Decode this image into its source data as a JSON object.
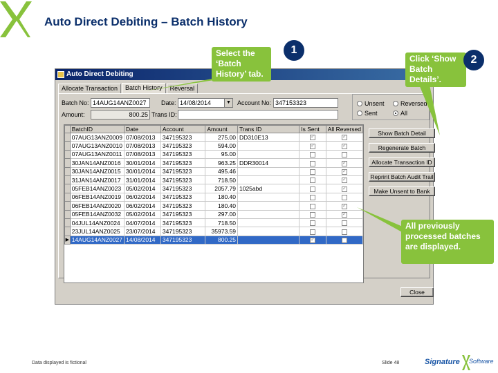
{
  "slide": {
    "title": "Auto Direct Debiting – Batch History",
    "footer_note": "Data displayed is fictional",
    "slide_number": "Slide 48",
    "brand": {
      "signature": "Signature",
      "software": "Software"
    },
    "colors": {
      "title": "#0b2f6b",
      "callout": "#88c23c",
      "badge": "#0b2f6b",
      "selection": "#3169c6"
    }
  },
  "window": {
    "title": "Auto Direct Debiting",
    "tabs": [
      "Allocate Transaction",
      "Batch History",
      "Reversal"
    ],
    "active_tab": "Batch History",
    "fields": {
      "batch_no_label": "Batch No:",
      "batch_no_value": "14AUG14ANZ0027",
      "date_label": "Date:",
      "date_value": "14/08/2014",
      "account_no_label": "Account No:",
      "account_no_value": "347153323",
      "amount_label": "Amount:",
      "amount_value": "800.25",
      "trans_id_label": "Trans ID:",
      "trans_id_value": ""
    },
    "filter": {
      "options": [
        "Unsent",
        "Reversed",
        "Sent",
        "All"
      ],
      "selected": "All"
    },
    "grid": {
      "columns": [
        "BatchID",
        "Date",
        "Account",
        "Amount",
        "Trans ID",
        "Is Sent",
        "All Reversed"
      ],
      "rows": [
        {
          "batch": "07AUG13ANZ0009",
          "date": "07/08/2013",
          "account": "347195323",
          "amount": "275.00",
          "trans": "DD310E13",
          "sent": true,
          "reversed": true
        },
        {
          "batch": "07AUG13ANZ0010",
          "date": "07/08/2013",
          "account": "347195323",
          "amount": "594.00",
          "trans": "",
          "sent": true,
          "reversed": true
        },
        {
          "batch": "07AUG13ANZ0011",
          "date": "07/08/2013",
          "account": "347195323",
          "amount": "95.00",
          "trans": "",
          "sent": false,
          "reversed": false
        },
        {
          "batch": "30JAN14ANZ0016",
          "date": "30/01/2014",
          "account": "347195323",
          "amount": "963.25",
          "trans": "DDR30014",
          "sent": false,
          "reversed": true
        },
        {
          "batch": "30JAN14ANZ0015",
          "date": "30/01/2014",
          "account": "347195323",
          "amount": "495.46",
          "trans": "",
          "sent": false,
          "reversed": true
        },
        {
          "batch": "31JAN14ANZ0017",
          "date": "31/01/2014",
          "account": "347195323",
          "amount": "718.50",
          "trans": "",
          "sent": false,
          "reversed": true
        },
        {
          "batch": "05FEB14ANZ0023",
          "date": "05/02/2014",
          "account": "347195323",
          "amount": "2057.79",
          "trans": "1025abd",
          "sent": false,
          "reversed": true
        },
        {
          "batch": "06FEB14ANZ0019",
          "date": "06/02/2014",
          "account": "347195323",
          "amount": "180.40",
          "trans": "",
          "sent": false,
          "reversed": false
        },
        {
          "batch": "06FEB14ANZ0020",
          "date": "06/02/2014",
          "account": "347195323",
          "amount": "180.40",
          "trans": "",
          "sent": false,
          "reversed": true
        },
        {
          "batch": "05FEB14ANZ0032",
          "date": "05/02/2014",
          "account": "347195323",
          "amount": "297.00",
          "trans": "",
          "sent": false,
          "reversed": true
        },
        {
          "batch": "04JUL14ANZ0024",
          "date": "04/07/2014",
          "account": "347195323",
          "amount": "718.50",
          "trans": "",
          "sent": false,
          "reversed": false
        },
        {
          "batch": "23JUL14ANZ0025",
          "date": "23/07/2014",
          "account": "347195323",
          "amount": "35973.59",
          "trans": "",
          "sent": false,
          "reversed": false
        },
        {
          "batch": "14AUG14ANZ0027",
          "date": "14/08/2014",
          "account": "347195323",
          "amount": "800.25",
          "trans": "",
          "sent": true,
          "reversed": false
        }
      ],
      "selected_index": 12
    },
    "buttons": [
      "Show Batch Detail",
      "Regenerate Batch",
      "Allocate Transaction ID",
      "Reprint Batch Audit Trail",
      "Make Unsent to Bank"
    ],
    "close_label": "Close"
  },
  "callouts": {
    "one": {
      "number": "1",
      "text": "Select the ‘Batch History’ tab."
    },
    "two": {
      "number": "2",
      "text": "Click ‘Show Batch Details’."
    },
    "three": {
      "text": "All previously processed batches are displayed."
    }
  }
}
